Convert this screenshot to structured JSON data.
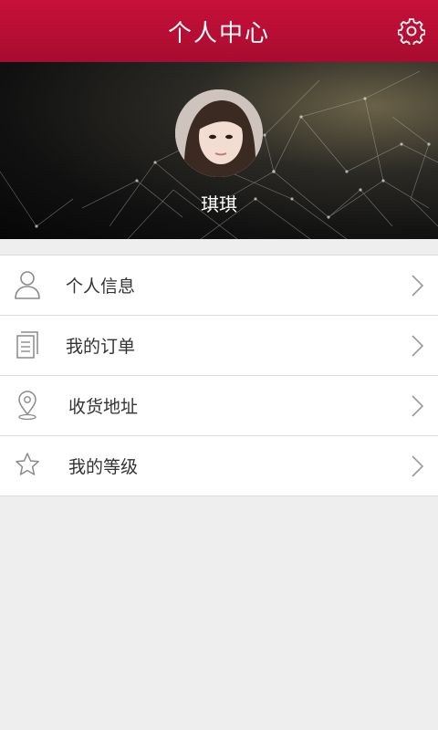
{
  "header": {
    "title": "个人中心",
    "settings_icon": "gear-icon"
  },
  "profile": {
    "name": "琪琪",
    "avatar": "avatar-photo"
  },
  "menu": {
    "items": [
      {
        "label": "个人信息",
        "icon": "user-icon"
      },
      {
        "label": "我的订单",
        "icon": "orders-icon"
      },
      {
        "label": "收货地址",
        "icon": "location-pin-icon"
      },
      {
        "label": "我的等级",
        "icon": "star-icon"
      }
    ]
  },
  "colors": {
    "header": "#b80e34",
    "text": "#333333",
    "icon": "#8a8a8a",
    "page_bg": "#eeeeee"
  }
}
